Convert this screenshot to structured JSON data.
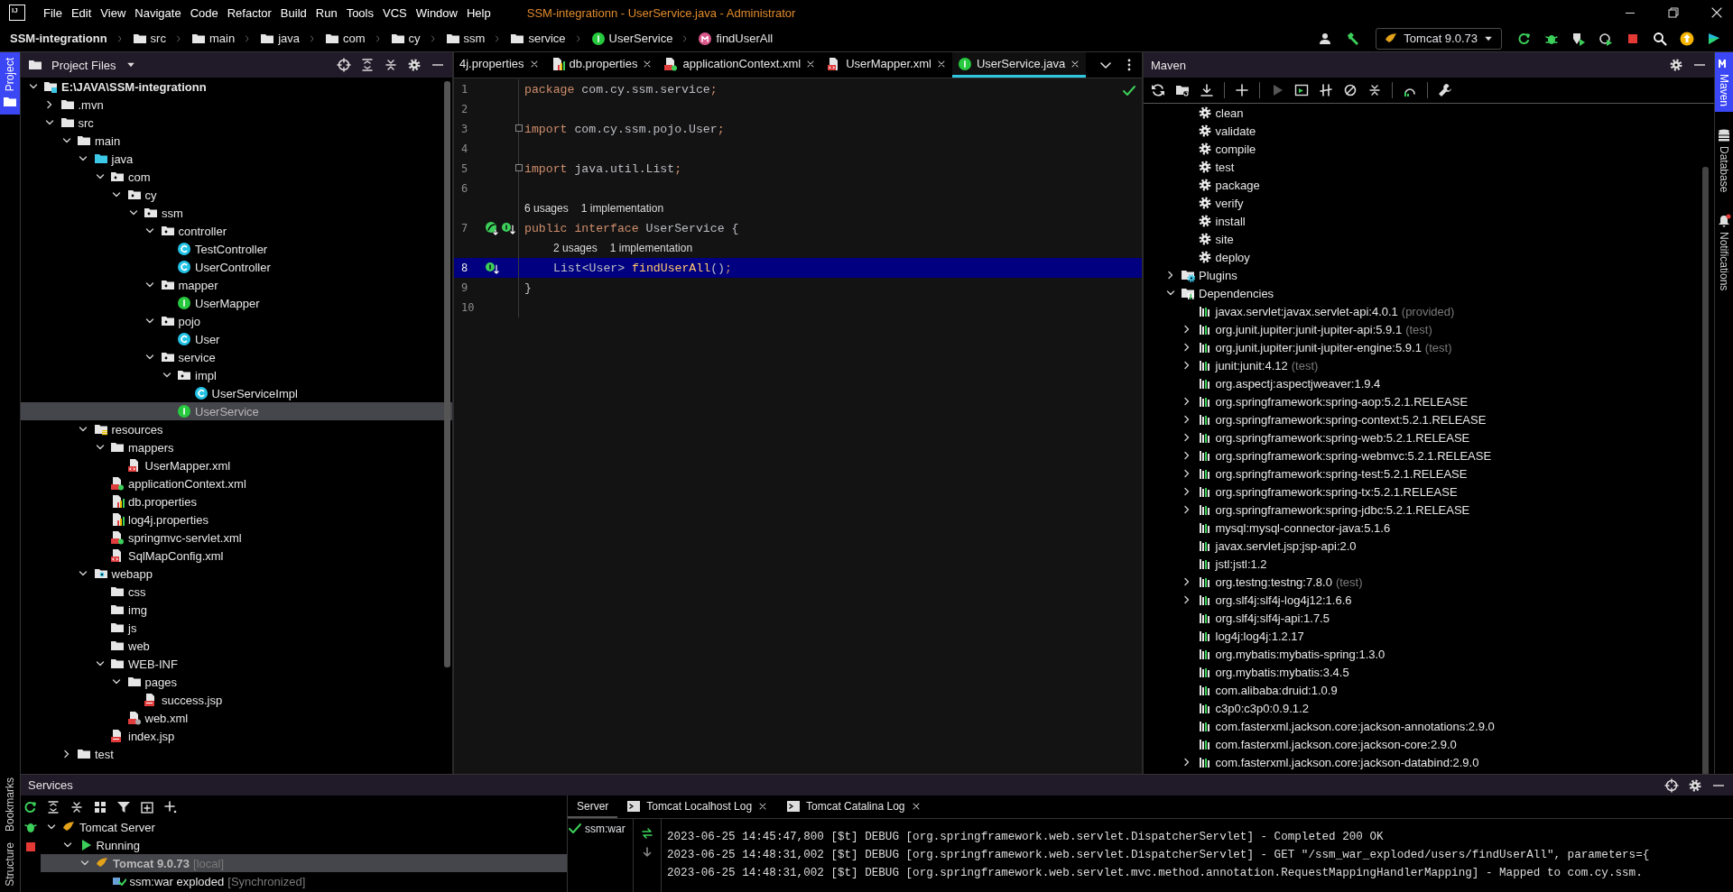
{
  "menu_bar": {
    "logo": "IJ",
    "menus": [
      "File",
      "Edit",
      "View",
      "Navigate",
      "Code",
      "Refactor",
      "Build",
      "Run",
      "Tools",
      "VCS",
      "Window",
      "Help"
    ],
    "title": "SSM-integrationn - UserService.java - Administrator"
  },
  "breadcrumb": [
    {
      "label": "SSM-integrationn",
      "kind": "project"
    },
    {
      "label": "src",
      "kind": "folder"
    },
    {
      "label": "main",
      "kind": "folder"
    },
    {
      "label": "java",
      "kind": "folder"
    },
    {
      "label": "com",
      "kind": "folder"
    },
    {
      "label": "cy",
      "kind": "folder"
    },
    {
      "label": "ssm",
      "kind": "folder"
    },
    {
      "label": "service",
      "kind": "folder"
    },
    {
      "label": "UserService",
      "kind": "interface"
    },
    {
      "label": "findUserAll",
      "kind": "method"
    }
  ],
  "run_config": "Tomcat 9.0.73",
  "left_stripe": [
    {
      "label": "Project",
      "selected": true
    },
    {
      "label": "Bookmarks",
      "selected": false
    },
    {
      "label": "Structure",
      "selected": false
    }
  ],
  "project_panel": {
    "title": "Project Files",
    "tree": [
      {
        "label": "E:\\JAVA\\SSM-integrationn",
        "kind": "module",
        "selected": false,
        "expanded": true,
        "children": [
          {
            "label": ".mvn",
            "kind": "folder",
            "selected": false,
            "expanded": false
          },
          {
            "label": "src",
            "kind": "folder",
            "selected": false,
            "expanded": true,
            "children": [
              {
                "label": "main",
                "kind": "folder",
                "selected": false,
                "expanded": true,
                "children": [
                  {
                    "label": "java",
                    "kind": "source",
                    "selected": false,
                    "expanded": true,
                    "children": [
                      {
                        "label": "com",
                        "kind": "package",
                        "selected": false,
                        "expanded": true,
                        "children": [
                          {
                            "label": "cy",
                            "kind": "package",
                            "selected": false,
                            "expanded": true,
                            "children": [
                              {
                                "label": "ssm",
                                "kind": "package",
                                "selected": false,
                                "expanded": true,
                                "children": [
                                  {
                                    "label": "controller",
                                    "kind": "package",
                                    "selected": false,
                                    "expanded": true,
                                    "children": [
                                      {
                                        "label": "TestController",
                                        "kind": "class",
                                        "selected": false
                                      },
                                      {
                                        "label": "UserController",
                                        "kind": "class",
                                        "selected": false
                                      }
                                    ]
                                  },
                                  {
                                    "label": "mapper",
                                    "kind": "package",
                                    "selected": false,
                                    "expanded": true,
                                    "children": [
                                      {
                                        "label": "UserMapper",
                                        "kind": "interface",
                                        "selected": false
                                      }
                                    ]
                                  },
                                  {
                                    "label": "pojo",
                                    "kind": "package",
                                    "selected": false,
                                    "expanded": true,
                                    "children": [
                                      {
                                        "label": "User",
                                        "kind": "class",
                                        "selected": false
                                      }
                                    ]
                                  },
                                  {
                                    "label": "service",
                                    "kind": "package",
                                    "selected": false,
                                    "expanded": true,
                                    "children": [
                                      {
                                        "label": "impl",
                                        "kind": "package",
                                        "selected": false,
                                        "expanded": true,
                                        "children": [
                                          {
                                            "label": "UserServiceImpl",
                                            "kind": "class",
                                            "selected": false
                                          }
                                        ]
                                      },
                                      {
                                        "label": "UserService",
                                        "kind": "interface",
                                        "selected": true
                                      }
                                    ]
                                  }
                                ]
                              }
                            ]
                          }
                        ]
                      }
                    ]
                  },
                  {
                    "label": "resources",
                    "kind": "resources",
                    "selected": false,
                    "expanded": true,
                    "children": [
                      {
                        "label": "mappers",
                        "kind": "folder",
                        "selected": false,
                        "expanded": true,
                        "children": [
                          {
                            "label": "UserMapper.xml",
                            "kind": "xml",
                            "selected": false
                          }
                        ]
                      },
                      {
                        "label": "applicationContext.xml",
                        "kind": "spring-xml",
                        "selected": false
                      },
                      {
                        "label": "db.properties",
                        "kind": "properties",
                        "selected": false
                      },
                      {
                        "label": "log4j.properties",
                        "kind": "properties",
                        "selected": false
                      },
                      {
                        "label": "springmvc-servlet.xml",
                        "kind": "spring-xml",
                        "selected": false
                      },
                      {
                        "label": "SqlMapConfig.xml",
                        "kind": "xml",
                        "selected": false
                      }
                    ]
                  },
                  {
                    "label": "webapp",
                    "kind": "web",
                    "selected": false,
                    "expanded": true,
                    "children": [
                      {
                        "label": "css",
                        "kind": "folder",
                        "selected": false
                      },
                      {
                        "label": "img",
                        "kind": "folder",
                        "selected": false
                      },
                      {
                        "label": "js",
                        "kind": "folder",
                        "selected": false
                      },
                      {
                        "label": "web",
                        "kind": "folder",
                        "selected": false
                      },
                      {
                        "label": "WEB-INF",
                        "kind": "folder",
                        "selected": false,
                        "expanded": true,
                        "children": [
                          {
                            "label": "pages",
                            "kind": "folder",
                            "selected": false,
                            "expanded": true,
                            "children": [
                              {
                                "label": "success.jsp",
                                "kind": "jsp",
                                "selected": false
                              }
                            ]
                          },
                          {
                            "label": "web.xml",
                            "kind": "web-xml",
                            "selected": false
                          }
                        ]
                      },
                      {
                        "label": "index.jsp",
                        "kind": "jsp",
                        "selected": false
                      }
                    ]
                  }
                ]
              },
              {
                "label": "test",
                "kind": "folder",
                "selected": false,
                "expanded": false
              }
            ]
          }
        ]
      }
    ]
  },
  "editor": {
    "tabs": [
      {
        "label": "4j.properties",
        "kind": "partial",
        "selected": false
      },
      {
        "label": "db.properties",
        "kind": "properties",
        "selected": false
      },
      {
        "label": "applicationContext.xml",
        "kind": "spring-xml",
        "selected": false
      },
      {
        "label": "UserMapper.xml",
        "kind": "xml",
        "selected": false
      },
      {
        "label": "UserService.java",
        "kind": "interface",
        "selected": true
      }
    ],
    "lines": [
      {
        "number": "1",
        "current": false,
        "tokens": [
          {
            "t": "package ",
            "kind": "keyword"
          },
          {
            "t": "com.cy.ssm.service",
            "kind": "plain"
          },
          {
            "t": ";",
            "kind": "punct"
          }
        ]
      },
      {
        "number": "2",
        "current": false
      },
      {
        "number": "3",
        "current": false,
        "fold": true,
        "tokens": [
          {
            "t": "import ",
            "kind": "keyword"
          },
          {
            "t": "com.cy.ssm.pojo.User",
            "kind": "plain"
          },
          {
            "t": ";",
            "kind": "punct"
          }
        ]
      },
      {
        "number": "4",
        "current": false
      },
      {
        "number": "5",
        "current": false,
        "fold": true,
        "tokens": [
          {
            "t": "import ",
            "kind": "keyword"
          },
          {
            "t": "java.util.List",
            "kind": "plain"
          },
          {
            "t": ";",
            "kind": "punct"
          }
        ]
      },
      {
        "number": "6",
        "current": false
      },
      {
        "number": "7",
        "current": false,
        "hints": [
          "6 usages",
          "1 implementation"
        ],
        "gutter": [
          {
            "kind": "spring"
          },
          {
            "kind": "implemented"
          }
        ],
        "tokens": [
          {
            "t": "public ",
            "kind": "keyword"
          },
          {
            "t": "interface ",
            "kind": "keyword"
          },
          {
            "t": "UserService {",
            "kind": "plain"
          }
        ]
      },
      {
        "number": "8",
        "current": true,
        "indented": true,
        "hints": [
          "2 usages",
          "1 implementation"
        ],
        "gutter": [
          {
            "kind": "implemented"
          }
        ],
        "tokens": [
          {
            "t": "List<User> ",
            "kind": "plain"
          },
          {
            "t": "findUserAll",
            "kind": "method"
          },
          {
            "t": "()",
            "kind": "plain"
          },
          {
            "t": ";",
            "kind": "punct"
          }
        ]
      },
      {
        "number": "9",
        "current": false,
        "tokens": [
          {
            "t": "}",
            "kind": "plain"
          }
        ]
      },
      {
        "number": "10",
        "current": false
      }
    ]
  },
  "maven": {
    "title": "Maven",
    "tree": [
      {
        "label": "clean",
        "kind": "goal",
        "selected": false
      },
      {
        "label": "validate",
        "kind": "goal",
        "selected": false
      },
      {
        "label": "compile",
        "kind": "goal",
        "selected": false
      },
      {
        "label": "test",
        "kind": "goal",
        "selected": false
      },
      {
        "label": "package",
        "kind": "goal",
        "selected": false
      },
      {
        "label": "verify",
        "kind": "goal",
        "selected": false
      },
      {
        "label": "install",
        "kind": "goal",
        "selected": false
      },
      {
        "label": "site",
        "kind": "goal",
        "selected": false
      },
      {
        "label": "deploy",
        "kind": "goal",
        "selected": false
      },
      {
        "label": "Plugins",
        "kind": "plugins",
        "selected": false,
        "expanded": false
      },
      {
        "label": "Dependencies",
        "kind": "dependencies",
        "selected": false,
        "expanded": true,
        "children": [
          {
            "label": "javax.servlet:javax.servlet-api:4.0.1",
            "scope": "(provided)",
            "kind": "library",
            "selected": false
          },
          {
            "label": "org.junit.jupiter:junit-jupiter-api:5.9.1",
            "scope": "(test)",
            "kind": "library",
            "selected": false,
            "expanded": false
          },
          {
            "label": "org.junit.jupiter:junit-jupiter-engine:5.9.1",
            "scope": "(test)",
            "kind": "library",
            "selected": false,
            "expanded": false
          },
          {
            "label": "junit:junit:4.12",
            "scope": "(test)",
            "kind": "library",
            "selected": false,
            "expanded": false
          },
          {
            "label": "org.aspectj:aspectjweaver:1.9.4",
            "kind": "library",
            "selected": false
          },
          {
            "label": "org.springframework:spring-aop:5.2.1.RELEASE",
            "kind": "library",
            "selected": false,
            "expanded": false
          },
          {
            "label": "org.springframework:spring-context:5.2.1.RELEASE",
            "kind": "library",
            "selected": false,
            "expanded": false
          },
          {
            "label": "org.springframework:spring-web:5.2.1.RELEASE",
            "kind": "library",
            "selected": false,
            "expanded": false
          },
          {
            "label": "org.springframework:spring-webmvc:5.2.1.RELEASE",
            "kind": "library",
            "selected": false,
            "expanded": false
          },
          {
            "label": "org.springframework:spring-test:5.2.1.RELEASE",
            "kind": "library",
            "selected": false,
            "expanded": false
          },
          {
            "label": "org.springframework:spring-tx:5.2.1.RELEASE",
            "kind": "library",
            "selected": false,
            "expanded": false
          },
          {
            "label": "org.springframework:spring-jdbc:5.2.1.RELEASE",
            "kind": "library",
            "selected": false,
            "expanded": false
          },
          {
            "label": "mysql:mysql-connector-java:5.1.6",
            "kind": "library",
            "selected": false
          },
          {
            "label": "javax.servlet.jsp:jsp-api:2.0",
            "kind": "library",
            "selected": false
          },
          {
            "label": "jstl:jstl:1.2",
            "kind": "library",
            "selected": false
          },
          {
            "label": "org.testng:testng:7.8.0",
            "scope": "(test)",
            "kind": "library",
            "selected": false,
            "expanded": false
          },
          {
            "label": "org.slf4j:slf4j-log4j12:1.6.6",
            "kind": "library",
            "selected": false,
            "expanded": false
          },
          {
            "label": "org.slf4j:slf4j-api:1.7.5",
            "kind": "library",
            "selected": false
          },
          {
            "label": "log4j:log4j:1.2.17",
            "kind": "library",
            "selected": false
          },
          {
            "label": "org.mybatis:mybatis-spring:1.3.0",
            "kind": "library",
            "selected": false
          },
          {
            "label": "org.mybatis:mybatis:3.4.5",
            "kind": "library",
            "selected": false
          },
          {
            "label": "com.alibaba:druid:1.0.9",
            "kind": "library",
            "selected": false
          },
          {
            "label": "c3p0:c3p0:0.9.1.2",
            "kind": "library",
            "selected": false
          },
          {
            "label": "com.fasterxml.jackson.core:jackson-annotations:2.9.0",
            "kind": "library",
            "selected": false
          },
          {
            "label": "com.fasterxml.jackson.core:jackson-core:2.9.0",
            "kind": "library",
            "selected": false
          },
          {
            "label": "com.fasterxml.jackson.core:jackson-databind:2.9.0",
            "kind": "library",
            "selected": false,
            "expanded": false
          }
        ]
      }
    ]
  },
  "right_stripe": [
    {
      "label": "Maven",
      "selected": true
    },
    {
      "label": "Database",
      "selected": false
    },
    {
      "label": "Notifications",
      "selected": false
    }
  ],
  "services": {
    "title": "Services",
    "tree": [
      {
        "label": "Tomcat Server",
        "kind": "server-group",
        "selected": false,
        "expanded": true,
        "children": [
          {
            "label": "Running",
            "kind": "running",
            "selected": false,
            "expanded": true,
            "children": [
              {
                "label": "Tomcat 9.0.73",
                "note": "[local]",
                "kind": "server",
                "selected": true,
                "expanded": true,
                "children": [
                  {
                    "label": "ssm:war exploded",
                    "note": "[Synchronized]",
                    "kind": "artifact",
                    "selected": false
                  }
                ]
              }
            ]
          }
        ]
      }
    ],
    "log_tabs": [
      {
        "label": "Server",
        "kind": "plain",
        "selected": true
      },
      {
        "label": "Tomcat Localhost Log",
        "kind": "log",
        "selected": false
      },
      {
        "label": "Tomcat Catalina Log",
        "kind": "log",
        "selected": false
      }
    ],
    "deployments": [
      "ssm:war"
    ],
    "log": [
      "2023-06-25 14:45:47,800 [$t] DEBUG [org.springframework.web.servlet.DispatcherServlet] - Completed 200 OK",
      "2023-06-25 14:48:31,002 [$t] DEBUG [org.springframework.web.servlet.DispatcherServlet] - GET \"/ssm_war_exploded/users/findUserAll\", parameters={",
      "2023-06-25 14:48:31,002 [$t] DEBUG [org.springframework.web.servlet.mvc.method.annotation.RequestMappingHandlerMapping] - Mapped to com.cy.ssm."
    ]
  }
}
